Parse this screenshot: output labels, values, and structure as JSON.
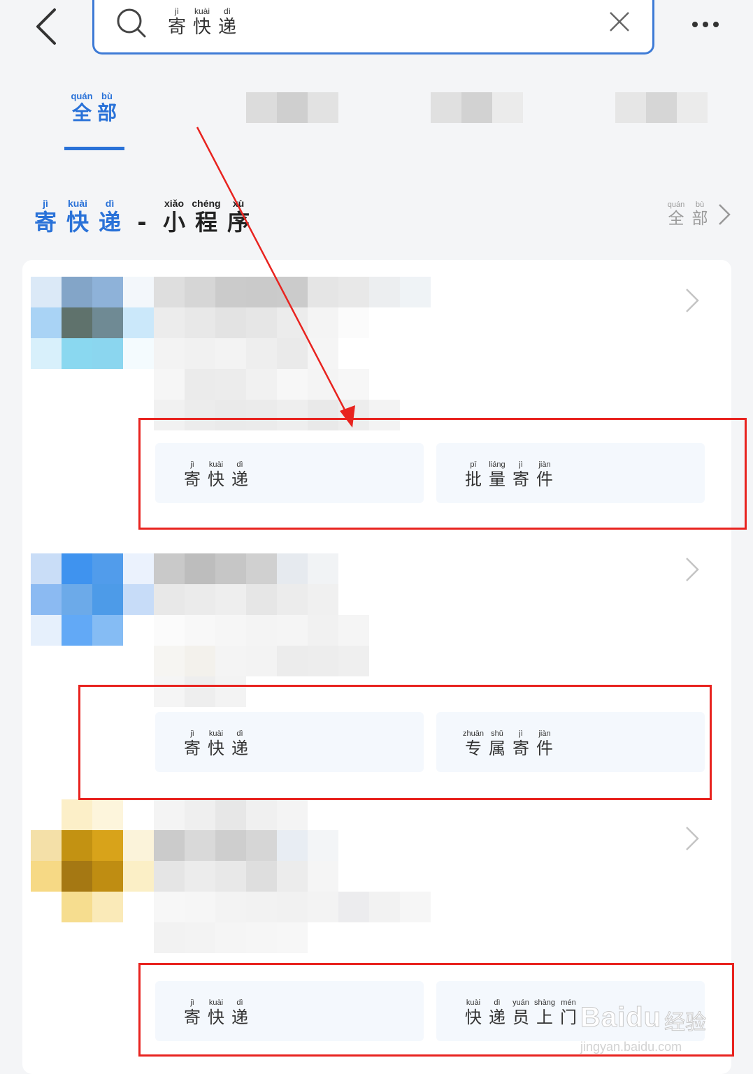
{
  "search": {
    "query_chars": [
      {
        "py": "jì",
        "hz": "寄"
      },
      {
        "py": "kuài",
        "hz": "快"
      },
      {
        "py": "dì",
        "hz": "递"
      }
    ]
  },
  "tabs": {
    "all": [
      {
        "py": "quán",
        "hz": "全"
      },
      {
        "py": "bù",
        "hz": "部"
      }
    ]
  },
  "section": {
    "title_chars": [
      {
        "py": "jì",
        "hz": "寄"
      },
      {
        "py": "kuài",
        "hz": "快"
      },
      {
        "py": "dì",
        "hz": "递"
      },
      {
        "py": "",
        "hz": "-"
      },
      {
        "py": "xiǎo",
        "hz": "小"
      },
      {
        "py": "chéng",
        "hz": "程"
      },
      {
        "py": "xù",
        "hz": "序"
      }
    ],
    "more_chars": [
      {
        "py": "quán",
        "hz": "全"
      },
      {
        "py": "bù",
        "hz": "部"
      }
    ]
  },
  "results": [
    {
      "actions": [
        [
          {
            "py": "jì",
            "hz": "寄"
          },
          {
            "py": "kuài",
            "hz": "快"
          },
          {
            "py": "dì",
            "hz": "递"
          }
        ],
        [
          {
            "py": "pī",
            "hz": "批"
          },
          {
            "py": "liáng",
            "hz": "量"
          },
          {
            "py": "jì",
            "hz": "寄"
          },
          {
            "py": "jiàn",
            "hz": "件"
          }
        ]
      ]
    },
    {
      "actions": [
        [
          {
            "py": "jì",
            "hz": "寄"
          },
          {
            "py": "kuài",
            "hz": "快"
          },
          {
            "py": "dì",
            "hz": "递"
          }
        ],
        [
          {
            "py": "zhuān",
            "hz": "专"
          },
          {
            "py": "shǔ",
            "hz": "属"
          },
          {
            "py": "jì",
            "hz": "寄"
          },
          {
            "py": "jiàn",
            "hz": "件"
          }
        ]
      ]
    },
    {
      "actions": [
        [
          {
            "py": "jì",
            "hz": "寄"
          },
          {
            "py": "kuài",
            "hz": "快"
          },
          {
            "py": "dì",
            "hz": "递"
          }
        ],
        [
          {
            "py": "kuài",
            "hz": "快"
          },
          {
            "py": "dì",
            "hz": "递"
          },
          {
            "py": "yuán",
            "hz": "员"
          },
          {
            "py": "shàng",
            "hz": "上"
          },
          {
            "py": "mén",
            "hz": "门"
          }
        ]
      ]
    }
  ],
  "watermark": {
    "brand": "Baidu",
    "brand_cn": "经验",
    "url": "jingyan.baidu.com"
  },
  "colors": {
    "accent": "#2a72d8",
    "annotation": "#e8231f",
    "background": "#f4f5f7"
  }
}
